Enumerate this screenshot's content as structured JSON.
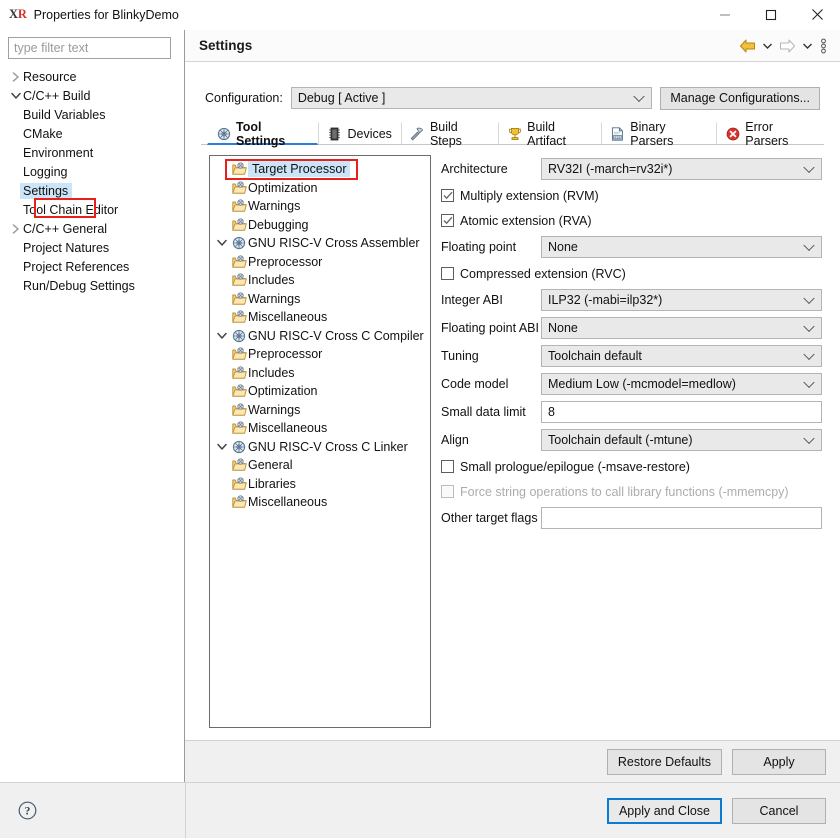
{
  "window": {
    "logo_x": "X",
    "logo_r": "R",
    "title": "Properties for BlinkyDemo",
    "minimize_icon": "minimize-icon",
    "maximize_icon": "maximize-icon",
    "close_icon": "close-icon"
  },
  "filter": {
    "placeholder": "type filter text",
    "value": ""
  },
  "nav": {
    "items": [
      {
        "label": "Resource",
        "indent": 0,
        "arrow": "collapsed",
        "selected": false
      },
      {
        "label": "C/C++ Build",
        "indent": 0,
        "arrow": "expanded",
        "selected": false
      },
      {
        "label": "Build Variables",
        "indent": 1,
        "arrow": "none",
        "selected": false
      },
      {
        "label": "CMake",
        "indent": 1,
        "arrow": "none",
        "selected": false
      },
      {
        "label": "Environment",
        "indent": 1,
        "arrow": "none",
        "selected": false
      },
      {
        "label": "Logging",
        "indent": 1,
        "arrow": "none",
        "selected": false
      },
      {
        "label": "Settings",
        "indent": 1,
        "arrow": "none",
        "selected": true
      },
      {
        "label": "Tool Chain Editor",
        "indent": 1,
        "arrow": "none",
        "selected": false
      },
      {
        "label": "C/C++ General",
        "indent": 0,
        "arrow": "collapsed",
        "selected": false
      },
      {
        "label": "Project Natures",
        "indent": 0,
        "arrow": "none",
        "selected": false
      },
      {
        "label": "Project References",
        "indent": 0,
        "arrow": "none",
        "selected": false
      },
      {
        "label": "Run/Debug Settings",
        "indent": 0,
        "arrow": "none",
        "selected": false
      }
    ]
  },
  "header": {
    "title": "Settings",
    "back_icon": "back-arrow-icon",
    "back_caret_icon": "chevron-down-icon",
    "forward_icon": "forward-arrow-icon",
    "forward_caret_icon": "chevron-down-icon",
    "menu_icon": "view-menu-icon",
    "back_color": "#e8a317",
    "forward_color": "#b9b9b9"
  },
  "configuration": {
    "label": "Configuration:",
    "value": "Debug  [ Active ]",
    "manage_button": "Manage Configurations..."
  },
  "tabs": [
    {
      "label": "Tool Settings",
      "icon": "gear-icon",
      "active": true
    },
    {
      "label": "Devices",
      "icon": "chip-icon",
      "active": false
    },
    {
      "label": "Build Steps",
      "icon": "hammer-icon",
      "active": false
    },
    {
      "label": "Build Artifact",
      "icon": "trophy-icon",
      "active": false
    },
    {
      "label": "Binary Parsers",
      "icon": "binary-file-icon",
      "active": false
    },
    {
      "label": "Error Parsers",
      "icon": "error-icon",
      "active": false
    }
  ],
  "tool_tree": {
    "items": [
      {
        "label": "Target Processor",
        "level": 1,
        "icon": "folder-tool-icon",
        "arrow": "none",
        "selected": true,
        "annotated": true
      },
      {
        "label": "Optimization",
        "level": 1,
        "icon": "folder-tool-icon",
        "arrow": "none",
        "selected": false,
        "annotated": false
      },
      {
        "label": "Warnings",
        "level": 1,
        "icon": "folder-tool-icon",
        "arrow": "none",
        "selected": false,
        "annotated": false
      },
      {
        "label": "Debugging",
        "level": 1,
        "icon": "folder-tool-icon",
        "arrow": "none",
        "selected": false,
        "annotated": false
      },
      {
        "label": "GNU RISC-V Cross Assembler",
        "level": 0,
        "icon": "gear-icon",
        "arrow": "expanded",
        "selected": false,
        "annotated": false
      },
      {
        "label": "Preprocessor",
        "level": 1,
        "icon": "folder-tool-icon",
        "arrow": "none",
        "selected": false,
        "annotated": false
      },
      {
        "label": "Includes",
        "level": 1,
        "icon": "folder-tool-icon",
        "arrow": "none",
        "selected": false,
        "annotated": false
      },
      {
        "label": "Warnings",
        "level": 1,
        "icon": "folder-tool-icon",
        "arrow": "none",
        "selected": false,
        "annotated": false
      },
      {
        "label": "Miscellaneous",
        "level": 1,
        "icon": "folder-tool-icon",
        "arrow": "none",
        "selected": false,
        "annotated": false
      },
      {
        "label": "GNU RISC-V Cross C Compiler",
        "level": 0,
        "icon": "gear-icon",
        "arrow": "expanded",
        "selected": false,
        "annotated": false
      },
      {
        "label": "Preprocessor",
        "level": 1,
        "icon": "folder-tool-icon",
        "arrow": "none",
        "selected": false,
        "annotated": false
      },
      {
        "label": "Includes",
        "level": 1,
        "icon": "folder-tool-icon",
        "arrow": "none",
        "selected": false,
        "annotated": false
      },
      {
        "label": "Optimization",
        "level": 1,
        "icon": "folder-tool-icon",
        "arrow": "none",
        "selected": false,
        "annotated": false
      },
      {
        "label": "Warnings",
        "level": 1,
        "icon": "folder-tool-icon",
        "arrow": "none",
        "selected": false,
        "annotated": false
      },
      {
        "label": "Miscellaneous",
        "level": 1,
        "icon": "folder-tool-icon",
        "arrow": "none",
        "selected": false,
        "annotated": false
      },
      {
        "label": "GNU RISC-V Cross C Linker",
        "level": 0,
        "icon": "gear-icon",
        "arrow": "expanded",
        "selected": false,
        "annotated": false
      },
      {
        "label": "General",
        "level": 1,
        "icon": "folder-tool-icon",
        "arrow": "none",
        "selected": false,
        "annotated": false
      },
      {
        "label": "Libraries",
        "level": 1,
        "icon": "folder-tool-icon",
        "arrow": "none",
        "selected": false,
        "annotated": false
      },
      {
        "label": "Miscellaneous",
        "level": 1,
        "icon": "folder-tool-icon",
        "arrow": "none",
        "selected": false,
        "annotated": false
      }
    ]
  },
  "options": {
    "architecture": {
      "label": "Architecture",
      "value": "RV32I (-march=rv32i*)"
    },
    "multiply_ext": {
      "label": "Multiply extension (RVM)",
      "checked": true,
      "enabled": true
    },
    "atomic_ext": {
      "label": "Atomic extension (RVA)",
      "checked": true,
      "enabled": true
    },
    "floating_point": {
      "label": "Floating point",
      "value": "None"
    },
    "compressed_ext": {
      "label": "Compressed extension (RVC)",
      "checked": false,
      "enabled": true
    },
    "integer_abi": {
      "label": "Integer ABI",
      "value": "ILP32 (-mabi=ilp32*)"
    },
    "floating_point_abi": {
      "label": "Floating point ABI",
      "value": "None"
    },
    "tuning": {
      "label": "Tuning",
      "value": "Toolchain default"
    },
    "code_model": {
      "label": "Code model",
      "value": "Medium Low (-mcmodel=medlow)"
    },
    "small_data_limit": {
      "label": "Small data limit",
      "value": "8"
    },
    "align": {
      "label": "Align",
      "value": "Toolchain default (-mtune)"
    },
    "small_prologue": {
      "label": "Small prologue/epilogue (-msave-restore)",
      "checked": false,
      "enabled": true
    },
    "force_string_ops": {
      "label": "Force string operations to call library functions (-mmemcpy)",
      "checked": false,
      "enabled": false
    },
    "other_target_flags": {
      "label": "Other target flags",
      "value": ""
    }
  },
  "buttons": {
    "restore_defaults": "Restore Defaults",
    "apply": "Apply",
    "apply_and_close": "Apply and Close",
    "cancel": "Cancel",
    "help_icon": "help-icon"
  },
  "colors": {
    "selection_blue": "#cce4f7",
    "annotation_red": "#e8201a",
    "focus_blue": "#0b7bd4",
    "active_tab_underline": "#2a7fd4"
  }
}
